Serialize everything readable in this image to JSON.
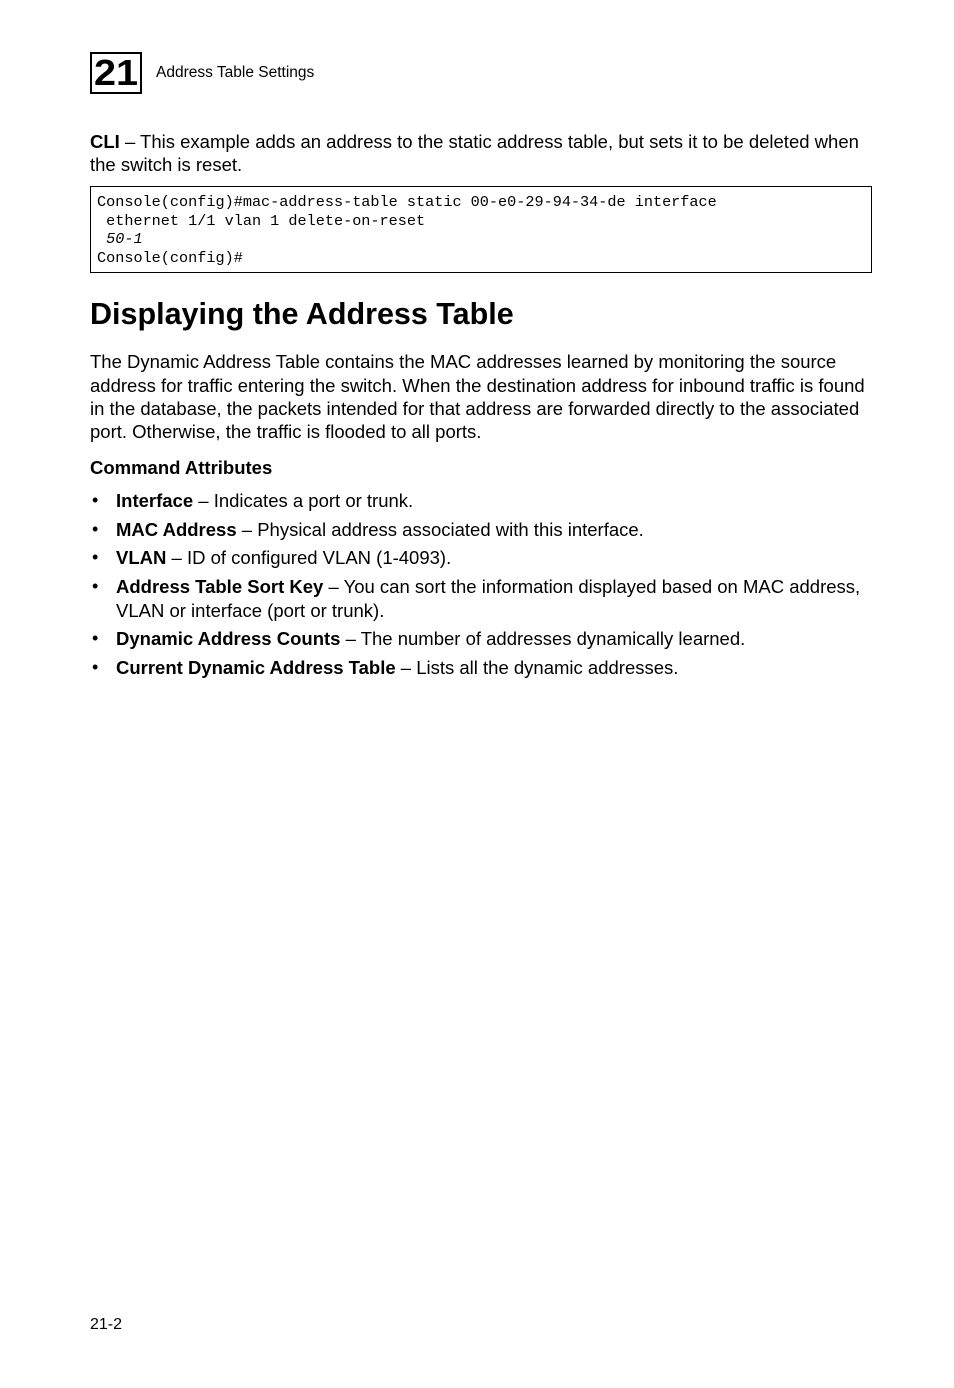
{
  "header": {
    "chapter_number": "21",
    "title": "Address Table Settings"
  },
  "intro_html": "<b>CLI</b> – This example adds an address to the static address table, but sets it to be deleted when the switch is reset.",
  "code": {
    "line1": "Console(config)#mac-address-table static 00-e0-29-94-34-de interface",
    "line2": " ethernet 1/1 vlan 1 delete-on-reset",
    "line3_italic": " 50-1",
    "line4": "Console(config)#"
  },
  "section_title": "Displaying the Address Table",
  "section_para": "The Dynamic Address Table contains the MAC addresses learned by monitoring the source address for traffic entering the switch. When the destination address for inbound traffic is found in the database, the packets intended for that address are forwarded directly to the associated port. Otherwise, the traffic is flooded to all ports.",
  "command_attrs_heading": "Command Attributes",
  "bullets": [
    {
      "html": "<b>Interface</b> – Indicates a port or trunk."
    },
    {
      "html": "<b>MAC Address</b> – Physical address associated with this interface."
    },
    {
      "html": "<b>VLAN</b> – ID of configured VLAN (1-4093)."
    },
    {
      "html": "<b>Address Table Sort Key</b> – You can sort the information displayed based on MAC address, VLAN or interface (port or trunk)."
    },
    {
      "html": "<b>Dynamic Address Counts</b> – The number of addresses dynamically learned."
    },
    {
      "html": "<b>Current Dynamic Address Table</b> – Lists all the dynamic addresses."
    }
  ],
  "page_number": "21-2"
}
